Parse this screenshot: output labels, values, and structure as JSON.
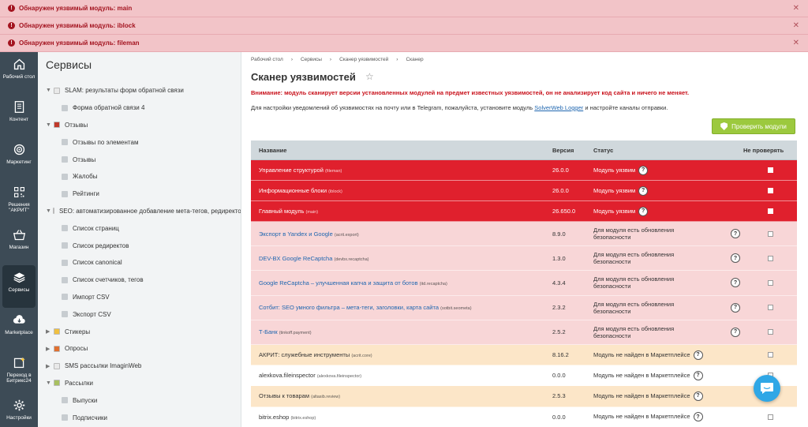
{
  "alerts": [
    {
      "text": "Обнаружен уязвимый модуль: main"
    },
    {
      "text": "Обнаружен уязвимый модуль: iblock"
    },
    {
      "text": "Обнаружен уязвимый модуль: fileman"
    }
  ],
  "left_menu": [
    {
      "label": "Рабочий стол",
      "icon": "home-icon"
    },
    {
      "label": "Контент",
      "icon": "document-icon"
    },
    {
      "label": "Маркетинг",
      "icon": "target-icon"
    },
    {
      "label": "Решения \"АКРИТ\"",
      "icon": "qr-icon"
    },
    {
      "label": "Магазин",
      "icon": "cart-icon"
    },
    {
      "label": "Сервисы",
      "icon": "layers-icon",
      "active": true
    },
    {
      "label": "Marketplace",
      "icon": "cloud-download-icon"
    },
    {
      "label": "Переход в Битрикс24",
      "icon": "bitrix24-icon"
    },
    {
      "label": "Настройки",
      "icon": "gear-icon"
    }
  ],
  "tree": {
    "title": "Сервисы",
    "items": [
      {
        "label": "SLAM: результаты форм обратной связи",
        "level": 0,
        "arrow": "▼",
        "icon": "#e9e9e9"
      },
      {
        "label": "Форма обратной связи 4",
        "level": 1
      },
      {
        "label": "Отзывы",
        "level": 0,
        "arrow": "▼",
        "icon": "#c0392b"
      },
      {
        "label": "Отзывы по элементам",
        "level": 1
      },
      {
        "label": "Отзывы",
        "level": 1
      },
      {
        "label": "Жалобы",
        "level": 1
      },
      {
        "label": "Рейтинги",
        "level": 1
      },
      {
        "label": "SEO: автоматизированное добавление мета-тегов, редиректов,",
        "level": 0,
        "arrow": "▼",
        "icon": "#e9e9e9"
      },
      {
        "label": "Список страниц",
        "level": 1
      },
      {
        "label": "Список редиректов",
        "level": 1
      },
      {
        "label": "Список canonical",
        "level": 1
      },
      {
        "label": "Список счетчиков, тегов",
        "level": 1
      },
      {
        "label": "Импорт CSV",
        "level": 1
      },
      {
        "label": "Экспорт CSV",
        "level": 1
      },
      {
        "label": "Стикеры",
        "level": 0,
        "arrow": "▶",
        "icon": "#f0c040"
      },
      {
        "label": "Опросы",
        "level": 0,
        "arrow": "▶",
        "icon": "#e07030"
      },
      {
        "label": "SMS рассылки ImaginWeb",
        "level": 0,
        "arrow": "▶",
        "icon": "#e9e9e9"
      },
      {
        "label": "Рассылки",
        "level": 0,
        "arrow": "▼",
        "icon": "#a8c060"
      },
      {
        "label": "Выпуски",
        "level": 1
      },
      {
        "label": "Подписчики",
        "level": 1
      }
    ]
  },
  "breadcrumb": [
    "Рабочий стол",
    "Сервисы",
    "Сканер уязвимостей",
    "Сканер"
  ],
  "page": {
    "title": "Сканер уязвимостей",
    "warning": "Внимание: модуль сканирует версии установленных модулей на предмет известных уязвимостей, он не анализирует код сайта и ничего не меняет.",
    "info_before": "Для настройки уведомлений об уязвимостях на почту или в Telegram, пожалуйста, установите модуль ",
    "info_link": "SolverWeb Logger",
    "info_after": " и настройте каналы отправки.",
    "check_button": "Проверить модули"
  },
  "table": {
    "headers": {
      "name": "Название",
      "version": "Версия",
      "status": "Статус",
      "skip": "Не проверять"
    },
    "rows": [
      {
        "name": "Управление структурой",
        "code": "(fileman)",
        "version": "26.0.0",
        "status": "Модуль уязвим",
        "type": "red"
      },
      {
        "name": "Информационные блоки",
        "code": "(iblock)",
        "version": "26.0.0",
        "status": "Модуль уязвим",
        "type": "red"
      },
      {
        "name": "Главный модуль",
        "code": "(main)",
        "version": "26.650.0",
        "status": "Модуль уязвим",
        "type": "red"
      },
      {
        "name": "Экспорт в Yandex и Google",
        "code": "(acrit.export)",
        "version": "8.9.0",
        "status": "Для модуля есть обновления безопасности",
        "type": "pink"
      },
      {
        "name": "DEV-BX Google ReCaptcha",
        "code": "(devbx.recaptcha)",
        "version": "1.3.0",
        "status": "Для модуля есть обновления безопасности",
        "type": "pink"
      },
      {
        "name": "Google ReCaptcha – улучшенная капча и защита от ботов",
        "code": "(itd.recaptcha)",
        "version": "4.3.4",
        "status": "Для модуля есть обновления безопасности",
        "type": "pink"
      },
      {
        "name": "Сотбит: SEO умного фильтра – мета-теги, заголовки, карта сайта",
        "code": "(sotbit.seometa)",
        "version": "2.3.2",
        "status": "Для модуля есть обновления безопасности",
        "type": "pink"
      },
      {
        "name": "Т-Банк",
        "code": "(tinkoff.payment)",
        "version": "2.5.2",
        "status": "Для модуля есть обновления безопасности",
        "type": "pink"
      },
      {
        "name": "АКРИТ: служебные инструменты",
        "code": "(acrit.core)",
        "version": "8.16.2",
        "status": "Модуль не найден в Маркетплейсе",
        "type": "orange"
      },
      {
        "name": "alexkova.fileinspector",
        "code": "(alexkova.fileinspector)",
        "version": "0.0.0",
        "status": "Модуль не найден в Маркетплейсе",
        "type": "white"
      },
      {
        "name": "Отзывы к товарам",
        "code": "(altasib.review)",
        "version": "2.5.3",
        "status": "Модуль не найден в Маркетплейсе",
        "type": "orange"
      },
      {
        "name": "bitrix.eshop",
        "code": "(bitrix.eshop)",
        "version": "0.0.0",
        "status": "Модуль не найден в Маркетплейсе",
        "type": "white"
      }
    ]
  },
  "icons": {
    "close": "✕",
    "question": "?",
    "star": "☆"
  },
  "colors": {
    "red": "#e0202d",
    "pink": "#f8d6d7",
    "orange": "#fce6c8",
    "alert_bg": "#f2c4c8",
    "button": "#9cc93e",
    "sidebar": "#3d4b56"
  }
}
